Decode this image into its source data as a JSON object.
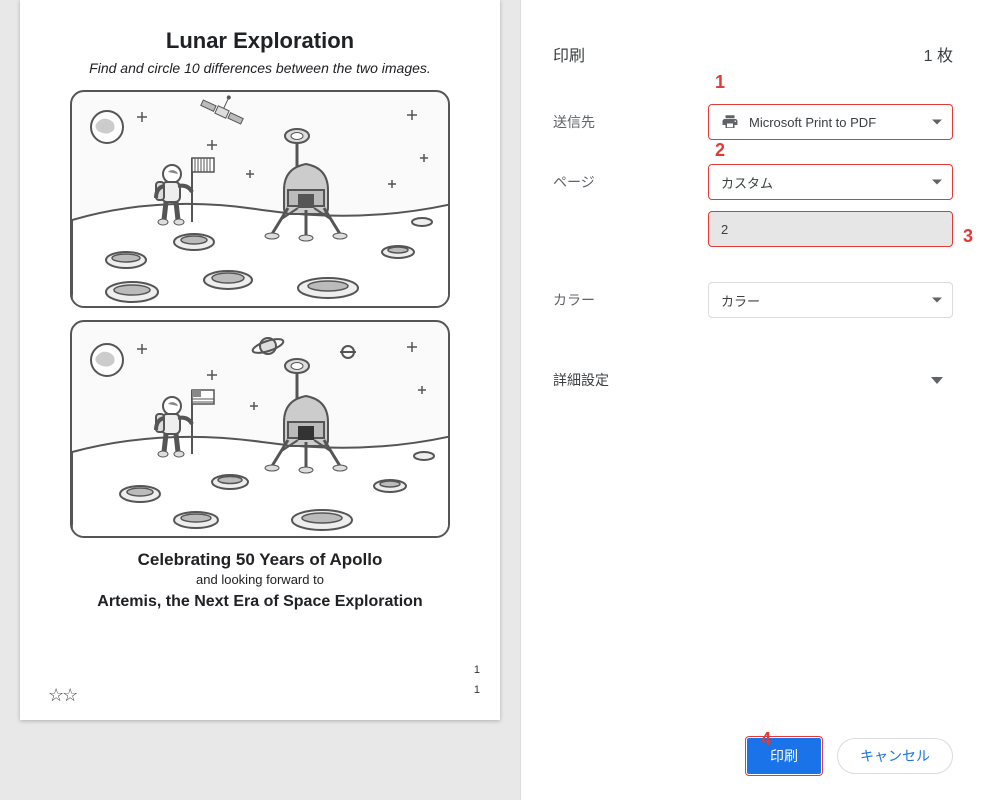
{
  "preview": {
    "title": "Lunar Exploration",
    "subtitle": "Find and circle 10 differences between the two images.",
    "footer_celebrating": "Celebrating 50 Years of Apollo",
    "footer_looking": "and looking forward to",
    "footer_artemis": "Artemis, the Next Era of Space Exploration",
    "stars": "☆☆",
    "corner_num_a": "1",
    "corner_num_b": "1",
    "scenes": [
      {
        "name": "scene-top"
      },
      {
        "name": "scene-bottom"
      }
    ]
  },
  "dialog": {
    "header_title": "印刷",
    "sheet_count_text": "1 枚",
    "destination_label": "送信先",
    "destination_value": "Microsoft Print to PDF",
    "pages_label": "ページ",
    "pages_mode": "カスタム",
    "pages_value": "2",
    "color_label": "カラー",
    "color_value": "カラー",
    "advanced_label": "詳細設定",
    "print_button": "印刷",
    "cancel_button": "キャンセル"
  },
  "annotations": {
    "a1": "1",
    "a2": "2",
    "a3": "3",
    "a4": "4"
  },
  "icons": {
    "printer": "printer-icon",
    "caret": "chevron-down-icon"
  }
}
